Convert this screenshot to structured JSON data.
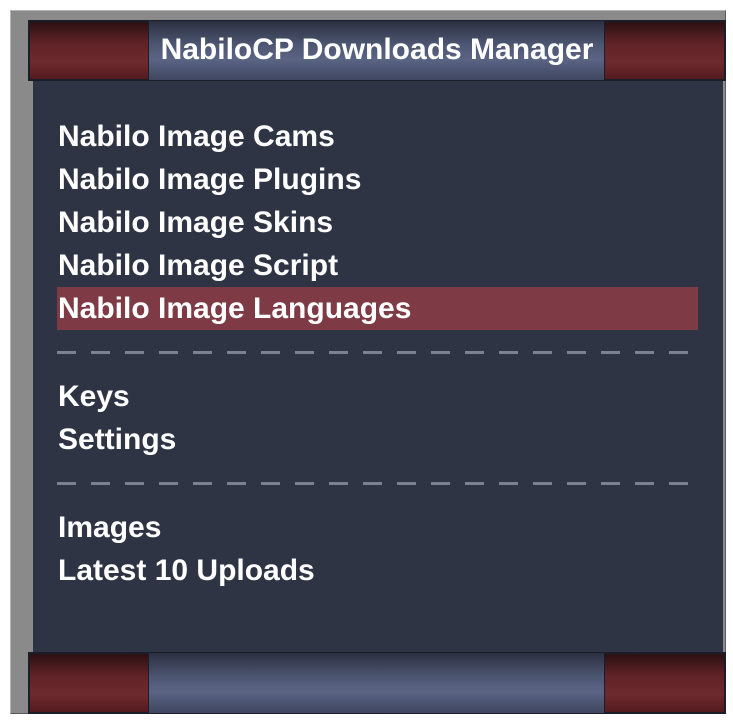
{
  "header": {
    "title": "NabiloCP Downloads Manager"
  },
  "menu": {
    "group1": [
      {
        "label": "Nabilo Image Cams",
        "active": false
      },
      {
        "label": "Nabilo Image Plugins",
        "active": false
      },
      {
        "label": "Nabilo Image Skins",
        "active": false
      },
      {
        "label": "Nabilo Image Script",
        "active": false
      },
      {
        "label": "Nabilo Image Languages",
        "active": true
      }
    ],
    "group2": [
      {
        "label": "Keys"
      },
      {
        "label": "Settings"
      }
    ],
    "group3": [
      {
        "label": "Images"
      },
      {
        "label": "Latest 10 Uploads"
      }
    ]
  },
  "colors": {
    "panel_bg": "#2f3445",
    "active_item_bg": "#7e3a45",
    "bar_cap": "#6e2a2e",
    "bar_center": "#5a6484",
    "frame": "#8a8a8a",
    "text": "#ffffff"
  }
}
